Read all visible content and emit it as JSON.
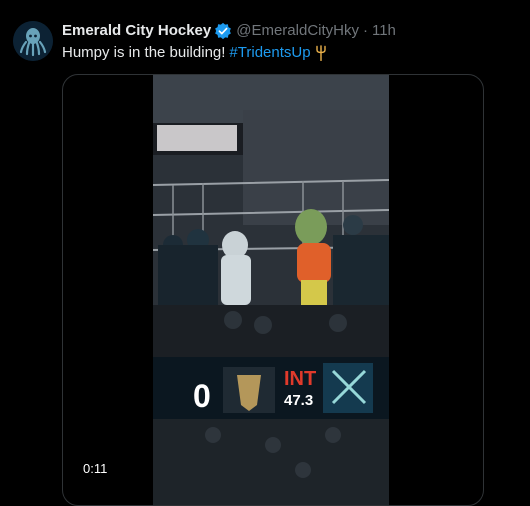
{
  "account": {
    "name": "Emerald City Hockey",
    "handle": "@EmeraldCityHky",
    "separator": "·",
    "time": "11h",
    "avatar_icon": "kraken-logo-icon",
    "verified_icon": "verified-badge-icon"
  },
  "tweet": {
    "text": "Humpy is in the building!",
    "hashtag": "#TridentsUp",
    "emoji_icon": "trident-icon"
  },
  "video": {
    "duration": "0:11",
    "scoreboard": {
      "score": "0",
      "period": "INT",
      "clock": "47.3"
    }
  },
  "colors": {
    "background": "#000000",
    "hashtag": "#1d9bf0",
    "verified": "#1d9bf0",
    "muted_text": "#71767b",
    "scoreboard_red": "#e03a2b"
  }
}
